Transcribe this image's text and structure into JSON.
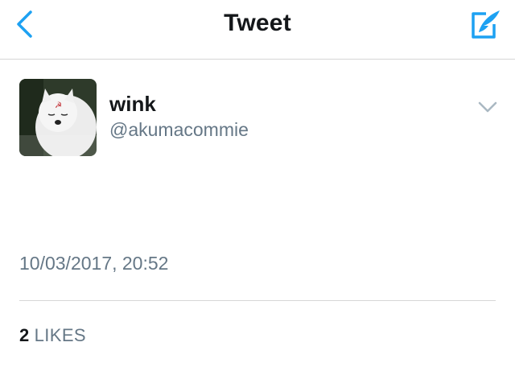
{
  "header": {
    "title": "Tweet",
    "back_icon": "chevron-left-icon",
    "compose_icon": "compose-quill-icon",
    "accent_color": "#1da1f2"
  },
  "tweet": {
    "author": {
      "display_name": "wink",
      "handle": "@akumacommie",
      "avatar": "avatar-image"
    },
    "more_icon": "chevron-down-icon",
    "text": "",
    "timestamp": "10/03/2017, 20:52",
    "stats": {
      "likes_count": "2",
      "likes_label": "LIKES"
    }
  }
}
